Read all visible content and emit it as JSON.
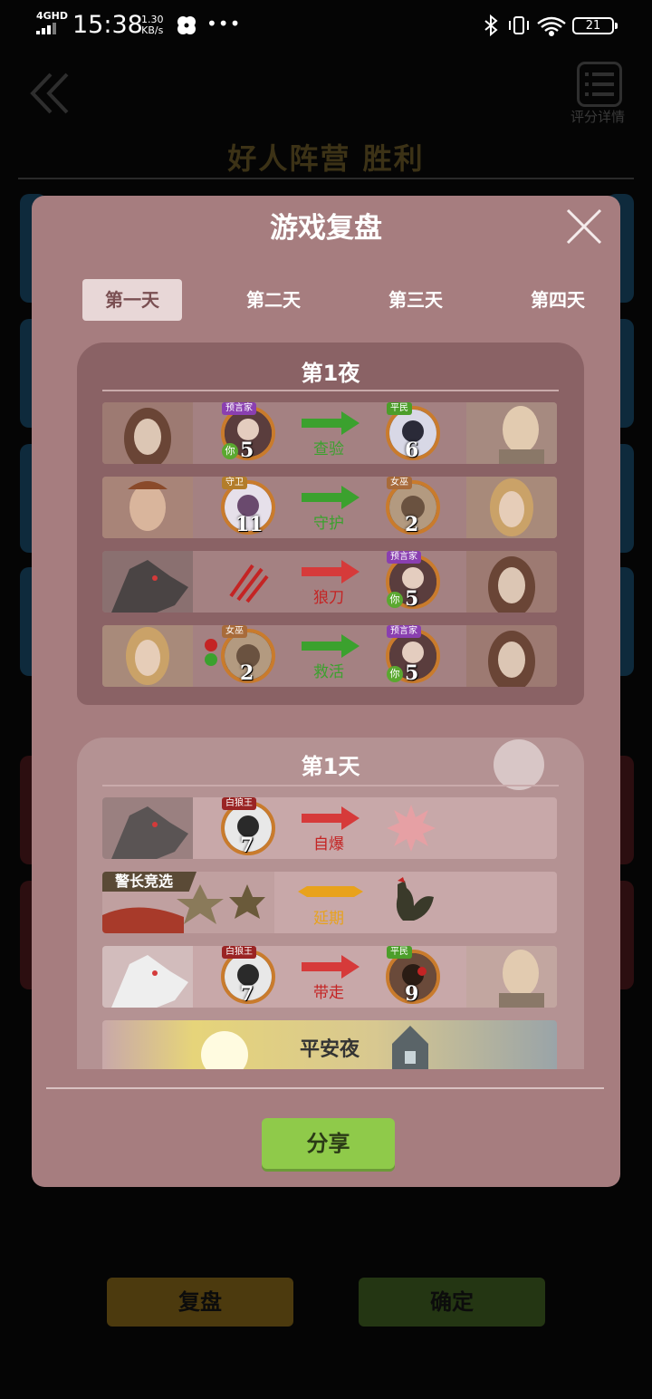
{
  "status_bar": {
    "network": "4GHD",
    "time": "15:38",
    "speed_value": "1.30",
    "speed_unit": "KB/s",
    "dots": "•••",
    "battery": "21"
  },
  "header": {
    "rating_label": "评分详情",
    "result_title": "好人阵营  胜利"
  },
  "bottom_buttons": {
    "replay": "复盘",
    "confirm": "确定"
  },
  "modal": {
    "title": "游戏复盘",
    "tabs": [
      {
        "label": "第一天",
        "active": true
      },
      {
        "label": "第二天",
        "active": false
      },
      {
        "label": "第三天",
        "active": false
      },
      {
        "label": "第四天",
        "active": false
      }
    ],
    "night": {
      "title": "第1夜",
      "rows": [
        {
          "actor_role": "预言家",
          "actor_num": "5",
          "actor_you": "你",
          "action": "查验",
          "target_role": "平民",
          "target_num": "6"
        },
        {
          "actor_role": "守卫",
          "actor_num": "11",
          "action": "守护",
          "target_role": "女巫",
          "target_num": "2"
        },
        {
          "action": "狼刀",
          "target_role": "预言家",
          "target_num": "5",
          "target_you": "你"
        },
        {
          "actor_role": "女巫",
          "actor_num": "2",
          "action": "救活",
          "target_role": "预言家",
          "target_num": "5",
          "target_you": "你"
        }
      ]
    },
    "day": {
      "title": "第1天",
      "rows": [
        {
          "actor_role": "白狼王",
          "actor_num": "7",
          "action": "自爆"
        },
        {
          "banner": "警长竞选",
          "action": "延期"
        },
        {
          "actor_role": "白狼王",
          "actor_num": "7",
          "action": "带走",
          "target_role": "平民",
          "target_num": "9"
        }
      ],
      "peaceful_night": "平安夜"
    },
    "share": "分享"
  },
  "colors": {
    "modal_bg": "#a67d7f",
    "green_action": "#3ba12e",
    "red_action": "#d63a3a",
    "gold_action": "#e8a21c",
    "share_button": "#8fca4a"
  }
}
